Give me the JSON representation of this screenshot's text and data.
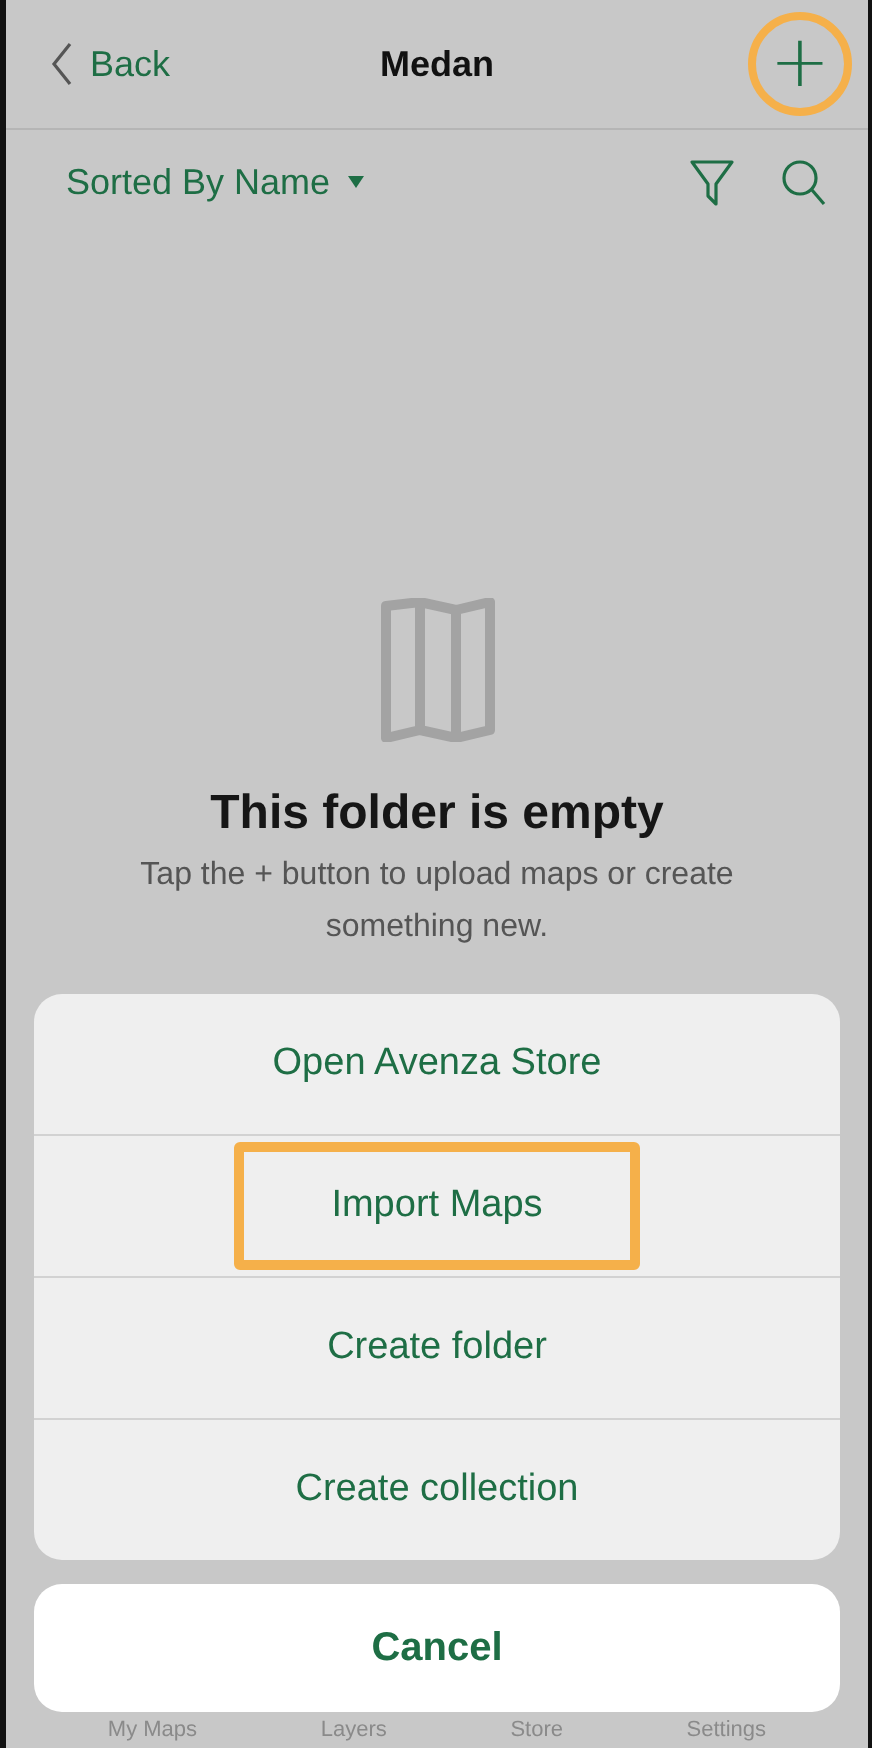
{
  "nav": {
    "back": "Back",
    "title": "Medan",
    "add": "+",
    "add_highlighted": true
  },
  "sort": {
    "label": "Sorted By Name"
  },
  "empty": {
    "title": "This folder is empty",
    "message": "Tap the + button to upload maps or create something new."
  },
  "actions": [
    {
      "label": "Open Avenza Store",
      "highlighted": false
    },
    {
      "label": "Import Maps",
      "highlighted": true
    },
    {
      "label": "Create folder",
      "highlighted": false
    },
    {
      "label": "Create collection",
      "highlighted": false
    }
  ],
  "cancel": "Cancel",
  "tabs": [
    "My Maps",
    "Layers",
    "Store",
    "Settings"
  ]
}
